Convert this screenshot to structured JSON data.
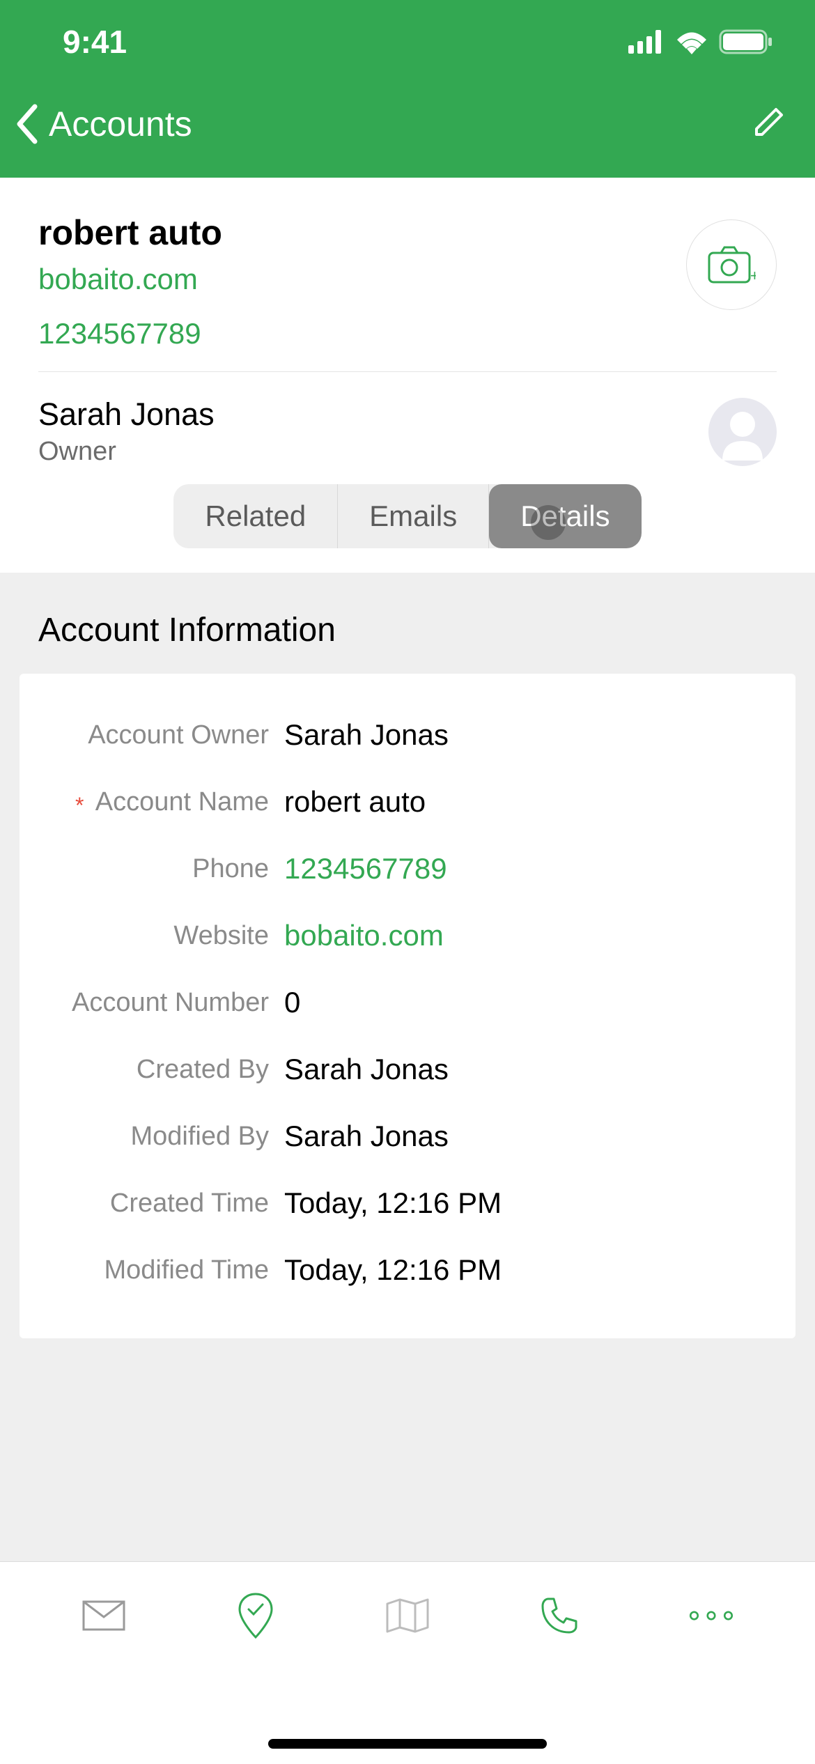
{
  "status": {
    "time": "9:41"
  },
  "nav": {
    "title": "Accounts"
  },
  "account": {
    "name": "robert auto",
    "website": "bobaito.com",
    "phone": "1234567789"
  },
  "owner": {
    "name": "Sarah Jonas",
    "label": "Owner"
  },
  "tabs": {
    "related": "Related",
    "emails": "Emails",
    "details": "Details"
  },
  "section": {
    "title": "Account Information"
  },
  "fields": {
    "account_owner": {
      "label": "Account Owner",
      "value": "Sarah Jonas"
    },
    "account_name": {
      "label": "Account Name",
      "value": "robert auto"
    },
    "phone": {
      "label": "Phone",
      "value": "1234567789"
    },
    "website": {
      "label": "Website",
      "value": "bobaito.com"
    },
    "account_number": {
      "label": "Account Number",
      "value": "0"
    },
    "created_by": {
      "label": "Created By",
      "value": "Sarah Jonas"
    },
    "modified_by": {
      "label": "Modified By",
      "value": "Sarah Jonas"
    },
    "created_time": {
      "label": "Created Time",
      "value": "Today, 12:16 PM"
    },
    "modified_time": {
      "label": "Modified Time",
      "value": "Today, 12:16 PM"
    }
  }
}
